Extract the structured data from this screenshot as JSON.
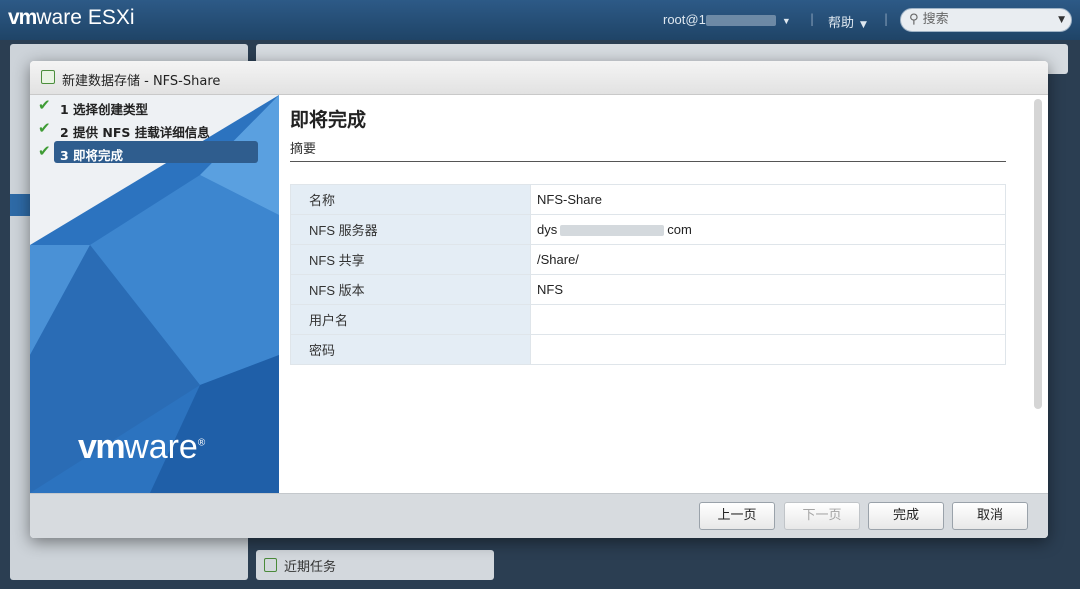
{
  "header": {
    "brand_vm": "vm",
    "brand_ware": "ware",
    "product": "ESXi",
    "user": "root@1",
    "help": "帮助",
    "search_placeholder": "搜索"
  },
  "background": {
    "recent_tasks": "近期任务"
  },
  "dialog": {
    "title": "新建数据存储 - NFS-Share",
    "steps": [
      {
        "label": "1 选择创建类型",
        "done": true
      },
      {
        "label": "2 提供 NFS 挂载详细信息",
        "done": true
      },
      {
        "label": "3 即将完成",
        "done": true,
        "active": true
      }
    ],
    "check_glyph": "✔",
    "logo_vm": "vm",
    "logo_ware": "ware",
    "logo_reg": "®",
    "heading": "即将完成",
    "subheading": "摘要",
    "summary": [
      {
        "key": "名称",
        "value": "NFS-Share"
      },
      {
        "key": "NFS 服务器",
        "value_prefix": "dys",
        "value_suffix": "com"
      },
      {
        "key": "NFS 共享",
        "value": "/Share/"
      },
      {
        "key": "NFS 版本",
        "value": "NFS"
      },
      {
        "key": "用户名",
        "value": ""
      },
      {
        "key": "密码",
        "value": ""
      }
    ],
    "buttons": {
      "back": "上一页",
      "next": "下一页",
      "finish": "完成",
      "cancel": "取消"
    },
    "next_disabled": true
  },
  "colors": {
    "active_step": "#2f5d8e",
    "key_cell": "#e4edf5",
    "check": "#3f9c35",
    "header": "#1f4467"
  }
}
